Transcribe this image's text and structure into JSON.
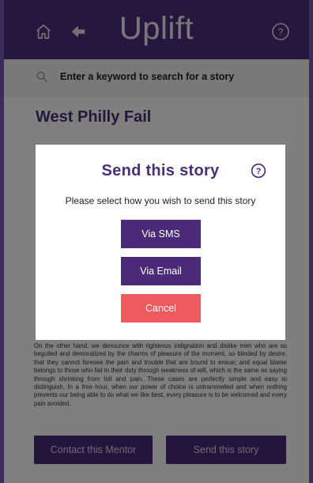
{
  "app": {
    "title": "Uplift"
  },
  "icons": {
    "home": "home-icon",
    "back": "arrow-left-icon",
    "help": "help-circle-icon",
    "search": "search-icon"
  },
  "search": {
    "placeholder": "Enter a keyword to search for a story"
  },
  "story": {
    "title": "West Philly Fail",
    "body": "On the other hand, we denounce with righteous indignation and dislike men who are so beguiled and demoralized by the charms of pleasure of the moment, so blinded by desire, that they cannot foresee the pain and trouble that are bound to ensue; and equal blame belongs to those who fail in their duty through weakness of will, which is the same as saying through shrinking from toil and pain. These cases are perfectly simple and easy to distinguish. In a free hour, when our power of choice is untrammelled and when nothing prevents our being able to do what we like best, every pleasure is to be welcomed and every pain avoided."
  },
  "actions": {
    "contact_label": "Contact this Mentor",
    "send_label": "Send this story"
  },
  "modal": {
    "title": "Send this story",
    "subtitle": "Please select how you wish to send this story",
    "sms_label": "Via SMS",
    "email_label": "Via Email",
    "cancel_label": "Cancel"
  },
  "colors": {
    "brand": "#512f7b",
    "button": "#4b2b79",
    "cancel": "#ef5a5e"
  }
}
